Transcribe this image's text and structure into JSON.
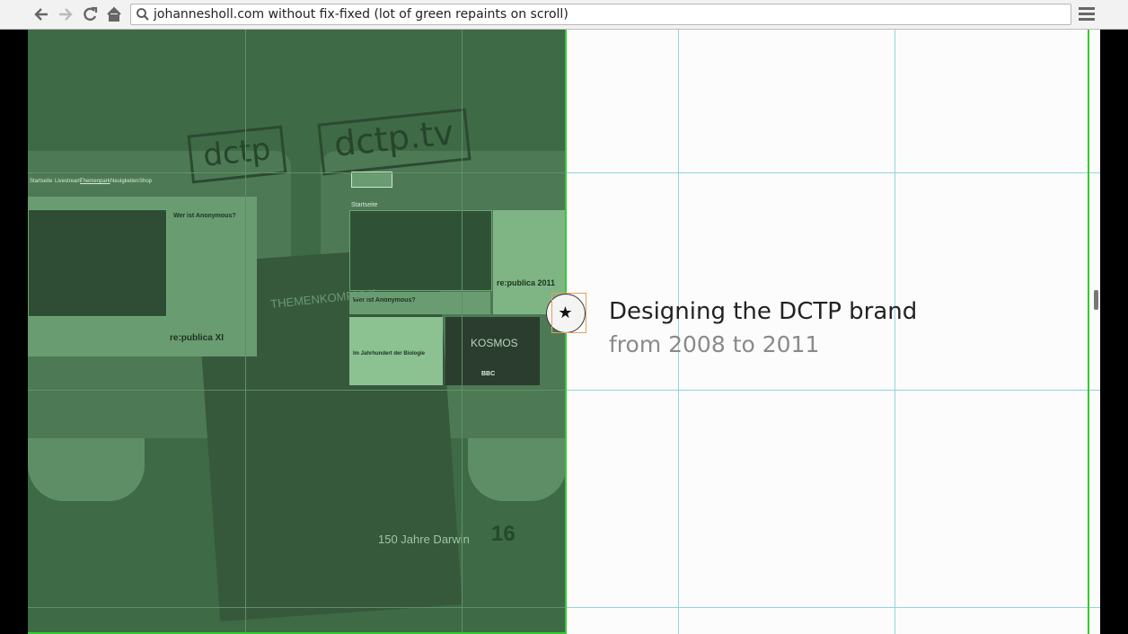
{
  "browser": {
    "url": "johannesholl.com without fix-fixed (lot of green repaints on scroll)",
    "icons": [
      "back-arrow-icon",
      "forward-arrow-icon",
      "reload-icon",
      "home-icon",
      "search-icon",
      "menu-icon"
    ]
  },
  "page": {
    "headline": "Designing the DCTP brand",
    "subheadline": "from 2008 to 2011",
    "star_button_icon": "star-icon"
  },
  "artwork": {
    "logo_left": "dctp",
    "logo_right": "dctp.tv",
    "nav_items": [
      "Startseite",
      "Livestream",
      "Themenpark",
      "Neuigkeiten",
      "Shop"
    ],
    "startseite": "Startseite",
    "republica": "re:publica 2011",
    "republica_xi": "re:publica XI",
    "anonymous_q": "Wer ist Anonymous?",
    "themenkomplex": "THEMENKOMPLEX",
    "kosmos": "KOSMOS",
    "biologie": "Im Jahrhundert der Biologie",
    "darwin": "150 Jahre Darwin",
    "sixteen": "16",
    "bbc": "BBC"
  },
  "colors": {
    "overlay_green": "#3e6a46",
    "paint_border": "#35c935",
    "grid": "#8fd4df",
    "page_bg": "#fdfcfd"
  }
}
